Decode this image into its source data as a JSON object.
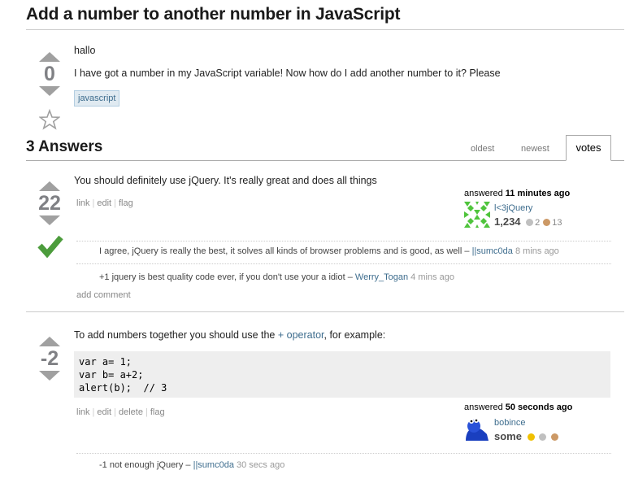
{
  "question": {
    "title": "Add a number to another number in JavaScript",
    "vote_count": "0",
    "body_line1": "hallo",
    "body_line2": "I have got a number in my JavaScript variable! Now how do I add another number to it? Please",
    "tag": "javascript"
  },
  "answers_header": {
    "count_label": "3 Answers",
    "tabs": [
      "oldest",
      "newest",
      "votes"
    ],
    "active_tab": "votes"
  },
  "answer1": {
    "vote_count": "22",
    "accepted": true,
    "body": "You should definitely use jQuery. It's really great and does all things",
    "menu": [
      "link",
      "edit",
      "flag"
    ],
    "answered_prefix": "answered",
    "answered_time": "11 minutes ago",
    "user": "l<3jQuery",
    "rep": "1,234",
    "silver_badges": "2",
    "bronze_badges": "13",
    "comments": [
      {
        "text": "I agree, jQuery is really the best, it solves all kinds of browser problems and is good, as well –",
        "user": "||sumc0da",
        "time": "8 mins ago"
      },
      {
        "text": "+1 jquery is best quality code ever, if you don't use your a idiot –",
        "user": "Werry_Togan",
        "time": "4 mins ago"
      }
    ],
    "add_comment": "add comment"
  },
  "answer2": {
    "vote_count": "-2",
    "body_prefix": "To add numbers together you should use the",
    "body_link": "+ operator",
    "body_suffix": ", for example:",
    "code": "var a= 1;\nvar b= a+2;\nalert(b);  // 3",
    "menu": [
      "link",
      "edit",
      "delete",
      "flag"
    ],
    "answered_prefix": "answered",
    "answered_time": "50 seconds ago",
    "user": "bobince",
    "rep": "some",
    "comments": [
      {
        "text": "-1 not enough jQuery –",
        "user": "||sumc0da",
        "time": "30 secs ago"
      }
    ]
  },
  "colors": {
    "link": "#3e6d8e",
    "accepted_check": "#4c9c3c",
    "vote_arrow": "#a0a0a0",
    "tag_bg": "#e0eaf1",
    "gold": "#f0c000",
    "silver": "#c0c0c0",
    "bronze": "#cc9966"
  }
}
